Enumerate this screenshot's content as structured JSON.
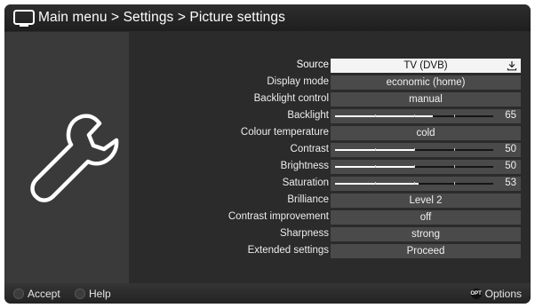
{
  "header": {
    "icon": "tv-icon",
    "breadcrumb": [
      "Main menu",
      "Settings",
      "Picture settings"
    ],
    "separator": ">"
  },
  "sidebar": {
    "icon": "wrench-icon"
  },
  "settings": [
    {
      "label": "Source",
      "type": "select",
      "value": "TV (DVB)",
      "selected": true
    },
    {
      "label": "Display mode",
      "type": "select",
      "value": "economic (home)"
    },
    {
      "label": "Backlight control",
      "type": "select",
      "value": "manual"
    },
    {
      "label": "Backlight",
      "type": "slider",
      "value": "65",
      "level": 0.62
    },
    {
      "label": "Colour temperature",
      "type": "select",
      "value": "cold"
    },
    {
      "label": "Contrast",
      "type": "slider",
      "value": "50",
      "level": 0.5
    },
    {
      "label": "Brightness",
      "type": "slider",
      "value": "50",
      "level": 0.5
    },
    {
      "label": "Saturation",
      "type": "slider",
      "value": "53",
      "level": 0.53
    },
    {
      "label": "Brilliance",
      "type": "select",
      "value": "Level 2"
    },
    {
      "label": "Contrast improvement",
      "type": "select",
      "value": "off"
    },
    {
      "label": "Sharpness",
      "type": "select",
      "value": "strong"
    },
    {
      "label": "Extended settings",
      "type": "select",
      "value": "Proceed"
    }
  ],
  "footer": {
    "accept_label": "Accept",
    "accept_color": "#3c3c3c",
    "help_label": "Help",
    "help_color": "#3c3c3c",
    "options_badge": "OPT",
    "options_label": "Options"
  }
}
